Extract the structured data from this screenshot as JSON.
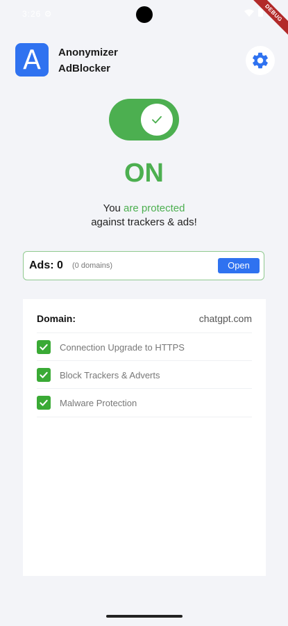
{
  "status": {
    "time": "3:26 ⚙",
    "debug": "DEBUG"
  },
  "header": {
    "logo_letter": "A",
    "title_line1": "Anonymizer",
    "title_line2": "AdBlocker",
    "settings_icon": "gear-icon"
  },
  "protection": {
    "toggle_on": true,
    "state_label": "ON",
    "msg_prefix": "You ",
    "msg_highlight": "are protected",
    "msg_line2": "against trackers & ads!"
  },
  "ads": {
    "label": "Ads: ",
    "count": "0",
    "domains": "(0 domains)",
    "open_label": "Open"
  },
  "domain": {
    "label": "Domain:",
    "value": "chatgpt.com"
  },
  "features": [
    {
      "label": "Connection Upgrade to HTTPS",
      "icon": "check-icon"
    },
    {
      "label": "Block Trackers & Adverts",
      "icon": "check-icon"
    },
    {
      "label": "Malware Protection",
      "icon": "check-icon"
    }
  ],
  "colors": {
    "accent_green": "#4caf50",
    "accent_blue": "#2f72f0"
  }
}
